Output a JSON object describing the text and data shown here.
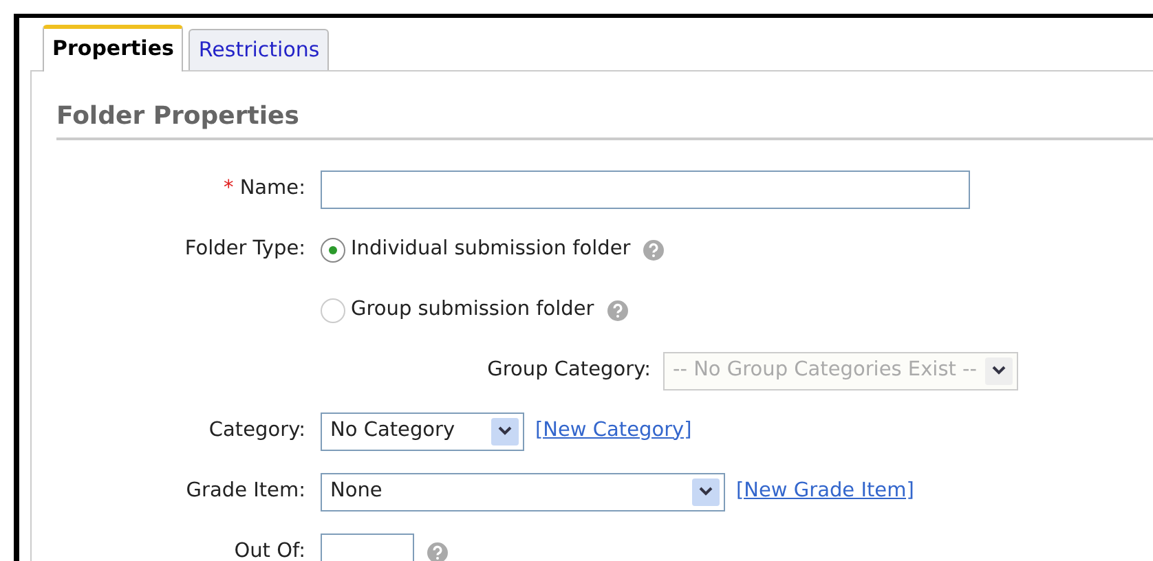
{
  "tabs": [
    {
      "label": "Properties",
      "selected": true
    },
    {
      "label": "Restrictions",
      "selected": false
    }
  ],
  "heading": "Folder Properties",
  "fields": [
    {
      "kind": "text",
      "label": "Name:",
      "required_mark": "*"
    },
    {
      "kind": "radio",
      "label": "Folder Type:",
      "option": "Individual submission folder",
      "selected": true,
      "help": true
    },
    {
      "kind": "radio",
      "option": "Group submission folder",
      "selected": false,
      "help": true
    },
    {
      "kind": "subselect",
      "label": "Group Category:",
      "value": "-- No Group Categories Exist --",
      "disabled": true
    },
    {
      "kind": "select",
      "label": "Category:",
      "value": "No Category",
      "link": "[New Category]"
    },
    {
      "kind": "select",
      "label": "Grade Item:",
      "value": "None",
      "link": "[New Grade Item]"
    },
    {
      "kind": "text",
      "label": "Out Of:",
      "help": true
    }
  ]
}
